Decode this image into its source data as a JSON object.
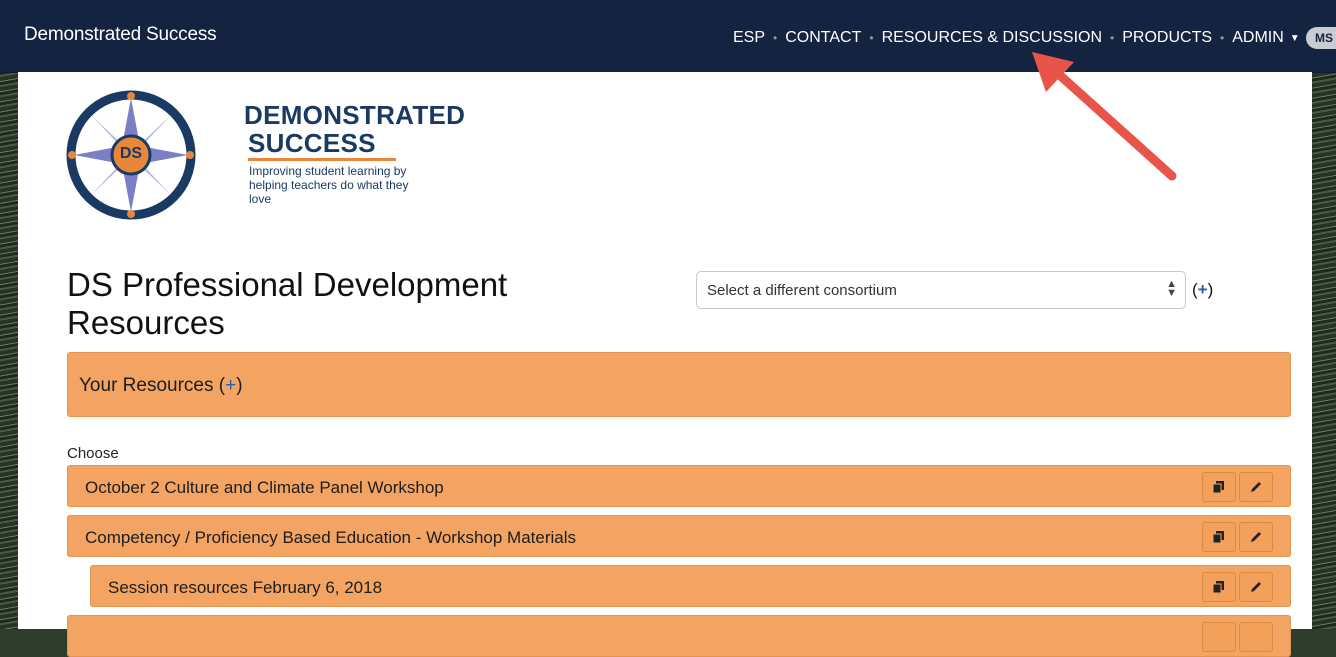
{
  "navbar": {
    "brand": "Demonstrated Success",
    "items": [
      {
        "label": "ESP"
      },
      {
        "label": "CONTACT"
      },
      {
        "label": "RESOURCES & DISCUSSION"
      },
      {
        "label": "PRODUCTS"
      },
      {
        "label": "ADMIN"
      }
    ],
    "separator": "•",
    "user_initials": "MS"
  },
  "logo": {
    "line1": "DEMONSTRATED",
    "line2": "SUCCESS",
    "tagline1": "Improving student learning by",
    "tagline2": "helping teachers do what they love",
    "badge": "DS"
  },
  "page": {
    "title": "DS Professional Development Resources",
    "consortium_select": {
      "value": "Select a different consortium"
    },
    "add_consortium": {
      "open": "(",
      "plus": "+",
      "close": ")"
    }
  },
  "your_resources": {
    "label": "Your Resources",
    "open": "(",
    "plus": "+",
    "close": ")"
  },
  "choose_label": "Choose",
  "resources": [
    {
      "title": "October 2 Culture and Climate Panel Workshop"
    },
    {
      "title": "Competency / Proficiency Based Education - Workshop Materials"
    },
    {
      "title": "Session resources February 6, 2018"
    }
  ],
  "colors": {
    "navbar": "#14233f",
    "resource_row": "#f4a462",
    "accent_plus": "#2b5fa6",
    "annotation_arrow": "#e9544a"
  },
  "icons": {
    "copy": "copy-icon",
    "edit": "pencil-icon"
  }
}
